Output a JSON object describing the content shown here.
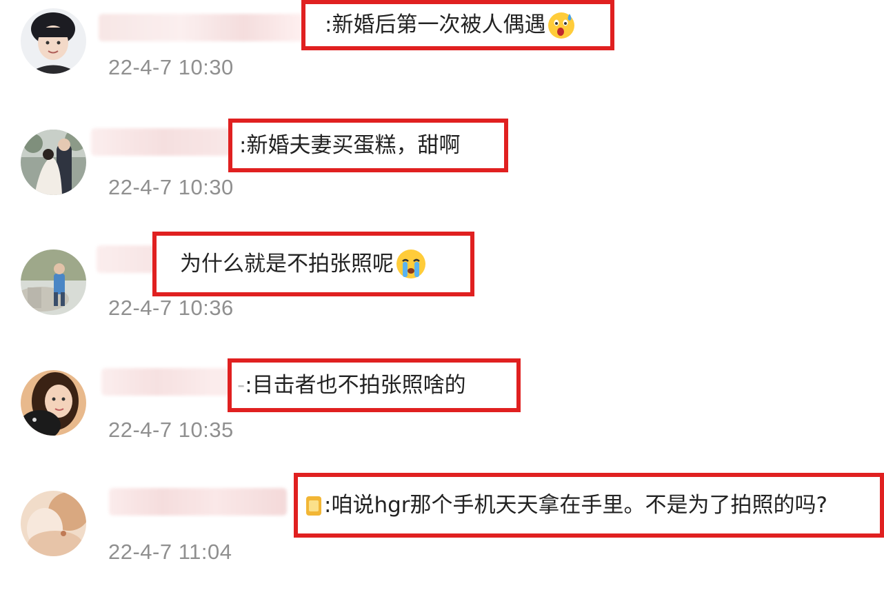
{
  "comments": [
    {
      "text": ":新婚后第一次被人偶遇",
      "emoji": "surprised-sweat-emoji",
      "timestamp": "22-4-7 10:30"
    },
    {
      "text": ":新婚夫妻买蛋糕，甜啊",
      "timestamp": "22-4-7 10:30"
    },
    {
      "text": "为什么就是不拍张照呢",
      "emoji": "crying-emoji",
      "timestamp": "22-4-7 10:36"
    },
    {
      "name_tail": "-",
      "text": ":目击者也不拍张照啥的",
      "timestamp": "22-4-7 10:35"
    },
    {
      "text": ":咱说hgr那个手机天天拿在手里。不是为了拍照的吗?",
      "timestamp": "22-4-7 11:04"
    }
  ],
  "colors": {
    "highlight_border": "#e02020",
    "timestamp": "#8f8f8f",
    "text": "#222222"
  }
}
